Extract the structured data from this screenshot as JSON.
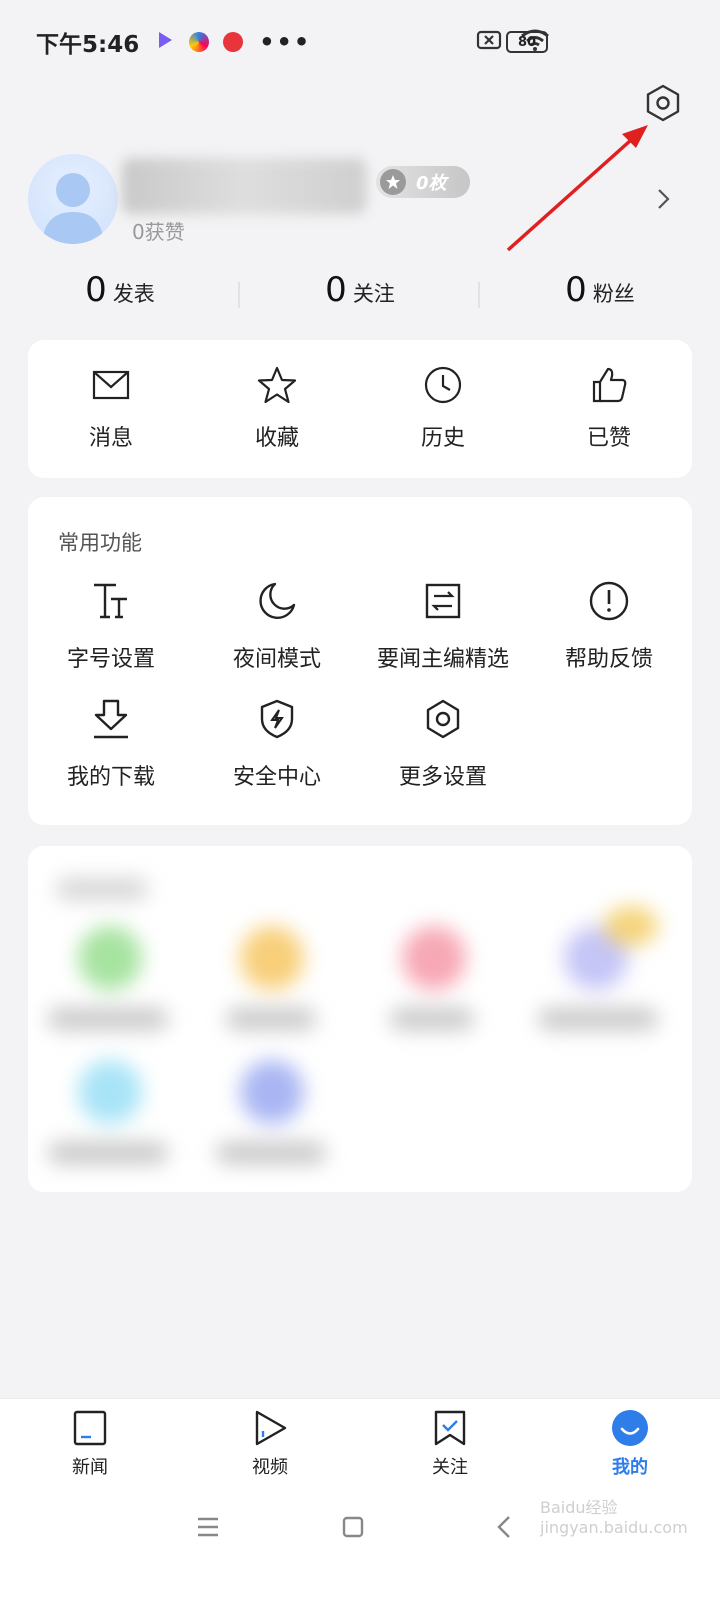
{
  "status_bar": {
    "time": "下午5:46",
    "more": "•••",
    "battery": "80"
  },
  "profile": {
    "likes": "0获赞",
    "medal": "0枚"
  },
  "stats": [
    {
      "num": "0",
      "label": "发表"
    },
    {
      "num": "0",
      "label": "关注"
    },
    {
      "num": "0",
      "label": "粉丝"
    }
  ],
  "quick_actions": [
    {
      "label": "消息",
      "icon": "mail-icon"
    },
    {
      "label": "收藏",
      "icon": "star-icon"
    },
    {
      "label": "历史",
      "icon": "clock-icon"
    },
    {
      "label": "已赞",
      "icon": "thumbs-up-icon"
    }
  ],
  "functions": {
    "title": "常用功能",
    "items": [
      {
        "label": "字号设置",
        "icon": "font-size-icon"
      },
      {
        "label": "夜间模式",
        "icon": "moon-icon"
      },
      {
        "label": "要闻主编精选",
        "icon": "swap-icon"
      },
      {
        "label": "帮助反馈",
        "icon": "help-icon"
      },
      {
        "label": "我的下载",
        "icon": "download-icon"
      },
      {
        "label": "安全中心",
        "icon": "shield-icon"
      },
      {
        "label": "更多设置",
        "icon": "settings-icon"
      }
    ]
  },
  "tabs": [
    {
      "label": "新闻",
      "icon": "news-icon",
      "active": false
    },
    {
      "label": "视频",
      "icon": "video-icon",
      "active": false
    },
    {
      "label": "关注",
      "icon": "bookmark-icon",
      "active": false
    },
    {
      "label": "我的",
      "icon": "profile-icon",
      "active": true
    }
  ],
  "watermark": "Baidu经验 jingyan.baidu.com",
  "colors": {
    "accent": "#2e7de9",
    "annotation_arrow": "#e02020",
    "background": "#f3f3f5"
  }
}
